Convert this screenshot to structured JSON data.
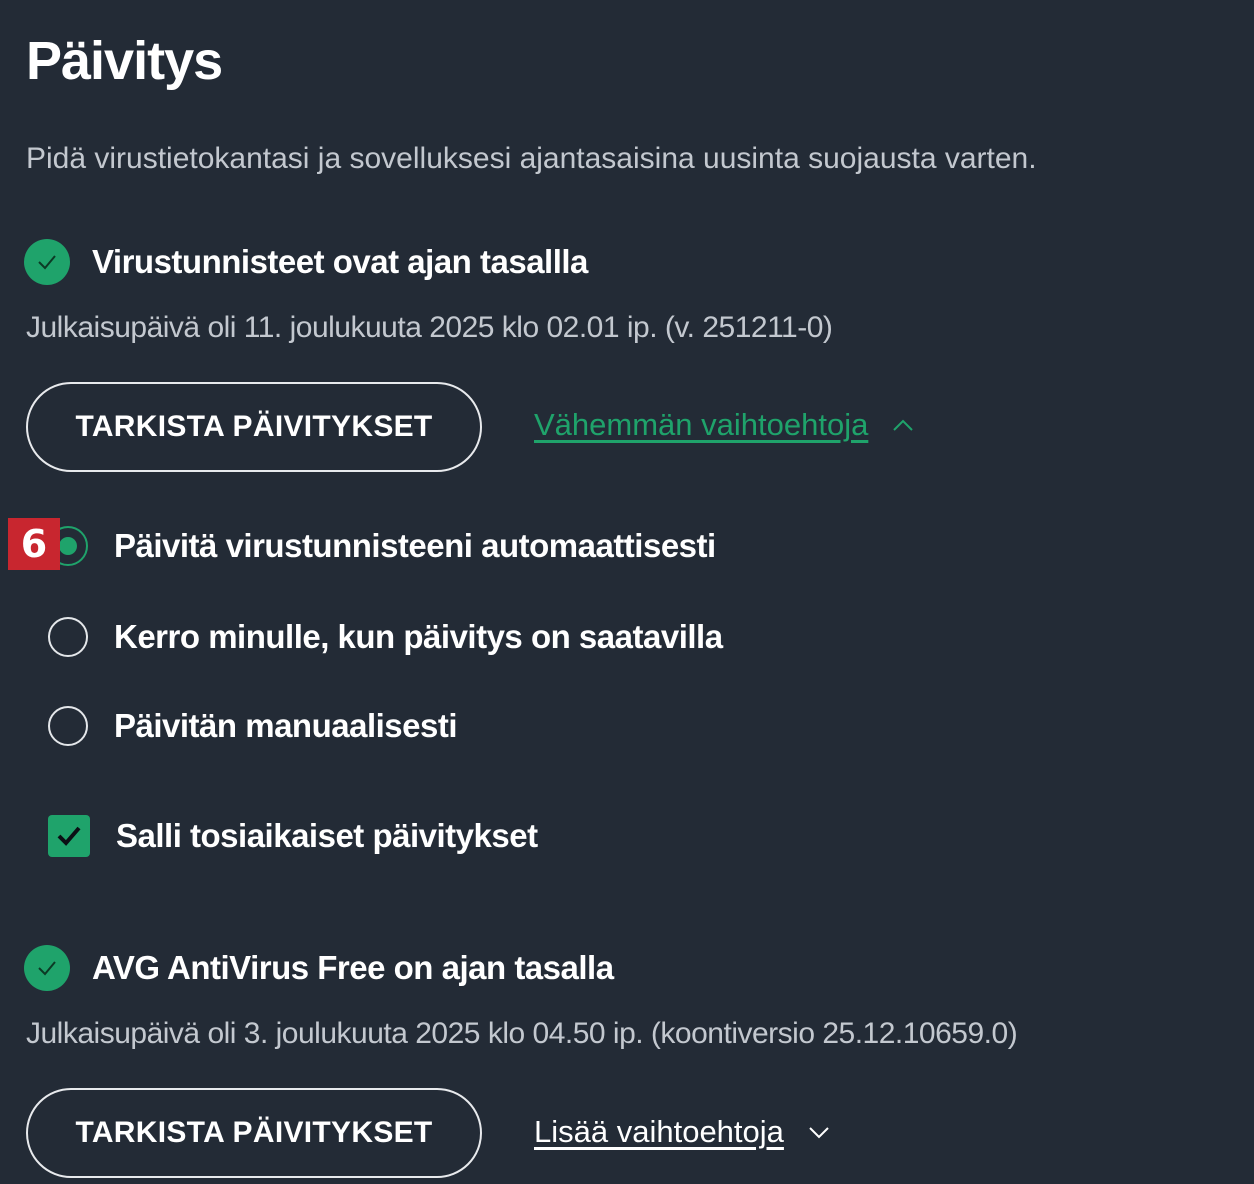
{
  "page": {
    "title": "Päivitys",
    "description": "Pidä virustietokantasi ja sovelluksesi ajantasaisina uusinta suojausta varten."
  },
  "virus_definitions": {
    "status_icon": "check-circle-icon",
    "status_title": "Virustunnisteet ovat ajan tasallla",
    "release_info": "Julkaisupäivä oli 11. joulukuuta 2025 klo 02.01 ip. (v. 251211-0)",
    "check_button": "TARKISTA PÄIVITYKSET",
    "options_toggle": "Vähemmän vaihtoehtoja",
    "options_toggle_icon": "chevron-up-icon",
    "step_badge": "6",
    "update_options": [
      {
        "label": "Päivitä virustunnisteeni automaattisesti",
        "selected": true
      },
      {
        "label": "Kerro minulle, kun päivitys on saatavilla",
        "selected": false
      },
      {
        "label": "Päivitän manuaalisesti",
        "selected": false
      }
    ],
    "realtime_checkbox": {
      "label": "Salli tosiaikaiset päivitykset",
      "checked": true
    }
  },
  "application": {
    "status_icon": "check-circle-icon",
    "status_title": "AVG AntiVirus Free on ajan tasalla",
    "release_info": "Julkaisupäivä oli 3. joulukuuta 2025 klo 04.50 ip. (koontiversio 25.12.10659.0)",
    "check_button": "TARKISTA PÄIVITYKSET",
    "options_toggle": "Lisää vaihtoehtoja",
    "options_toggle_icon": "chevron-down-icon"
  },
  "colors": {
    "background": "#232b36",
    "accent_green": "#1fa36b",
    "badge_red": "#c8262f",
    "muted_text": "#c3c8cf"
  }
}
